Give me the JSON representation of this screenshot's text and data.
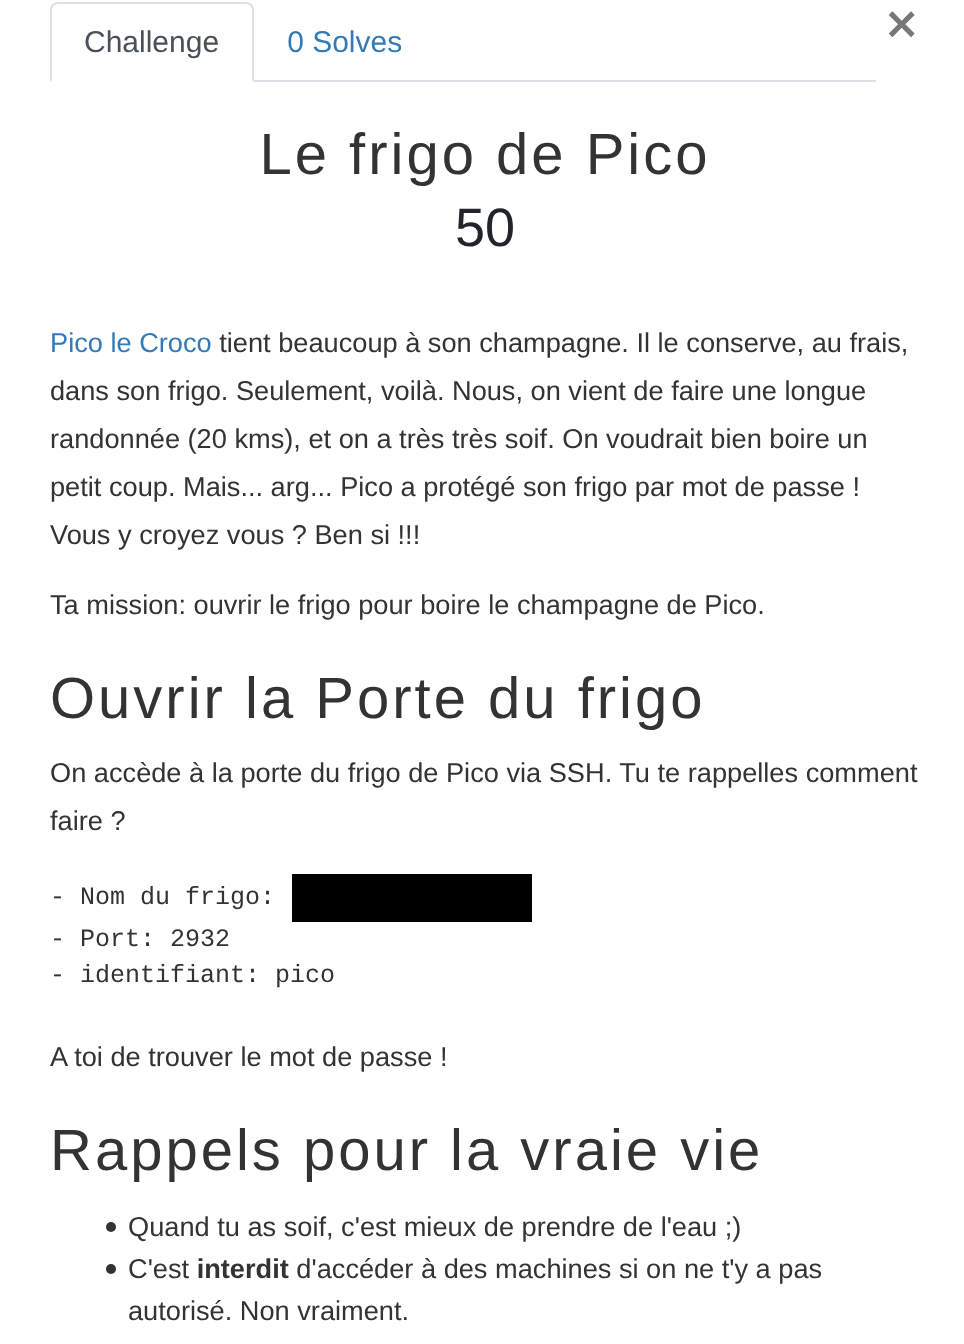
{
  "tabs": [
    {
      "label": "Challenge",
      "selected": true
    },
    {
      "label": "0 Solves",
      "selected": false
    }
  ],
  "close": "×",
  "title": "Le frigo de Pico",
  "points": "50",
  "intro": {
    "link": "Pico le Croco",
    "text": " tient beaucoup à son champagne. Il le conserve, au frais, dans son frigo. Seulement, voilà. Nous, on vient de faire une longue randonnée (20 kms), et on a très très soif. On voudrait bien boire un petit coup. Mais... arg... Pico a protégé son frigo par mot de passe ! Vous y croyez vous ? Ben si !!!"
  },
  "mission": "Ta mission: ouvrir le frigo pour boire le champagne de Pico.",
  "section_1": {
    "heading": "Ouvrir la Porte du frigo",
    "text": "On accède à la porte du frigo de Pico via SSH. Tu te rappelles comment faire ?",
    "code_lines": [
      {
        "text": "- Nom du frigo:",
        "redacted": true
      },
      {
        "text": "- Port: 2932",
        "redacted": false
      },
      {
        "text": "- identifiant: pico",
        "redacted": false
      }
    ],
    "after": "A toi de trouver le mot de passe !"
  },
  "section_2": {
    "heading": "Rappels pour la vraie vie",
    "items": [
      "Quand tu as soif, c'est mieux de prendre de l'eau ;)",
      "C'est **interdit** d'accéder à des machines si on ne t'y a pas autorisé. Non vraiment."
    ]
  }
}
